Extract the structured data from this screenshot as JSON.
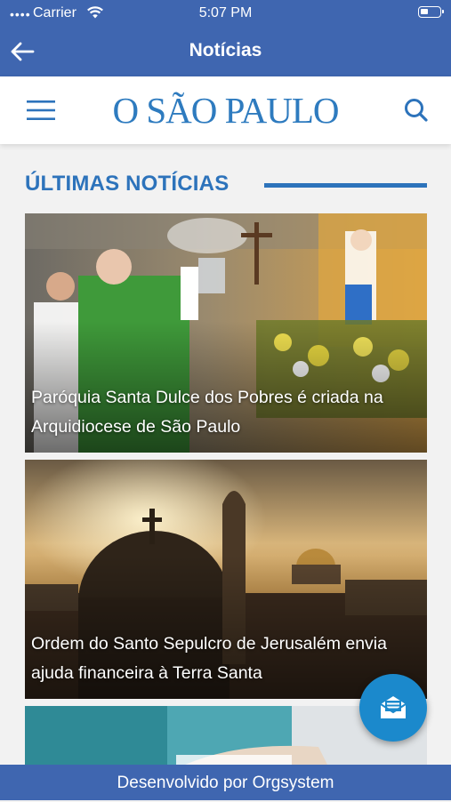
{
  "status_bar": {
    "carrier": "Carrier",
    "time": "5:07 PM"
  },
  "nav_bar": {
    "title": "Notícias"
  },
  "site_header": {
    "logo": "O SÃO PAULO"
  },
  "section": {
    "title": "ÚLTIMAS NOTÍCIAS"
  },
  "news": [
    {
      "caption": "Paróquia Santa Dulce dos Pobres é criada na Arquidiocese de São Paulo"
    },
    {
      "caption": "Ordem do Santo Sepulcro de Jerusalém envia ajuda financeira à Terra Santa"
    }
  ],
  "footer": {
    "text": "Desenvolvido por Orgsystem"
  },
  "colors": {
    "primary": "#3f66b0",
    "accent": "#2d73bb",
    "fab": "#1b89cc"
  },
  "icons": {
    "back": "arrow-left-icon",
    "menu": "hamburger-icon",
    "search": "search-icon",
    "fab": "envelope-icon"
  }
}
